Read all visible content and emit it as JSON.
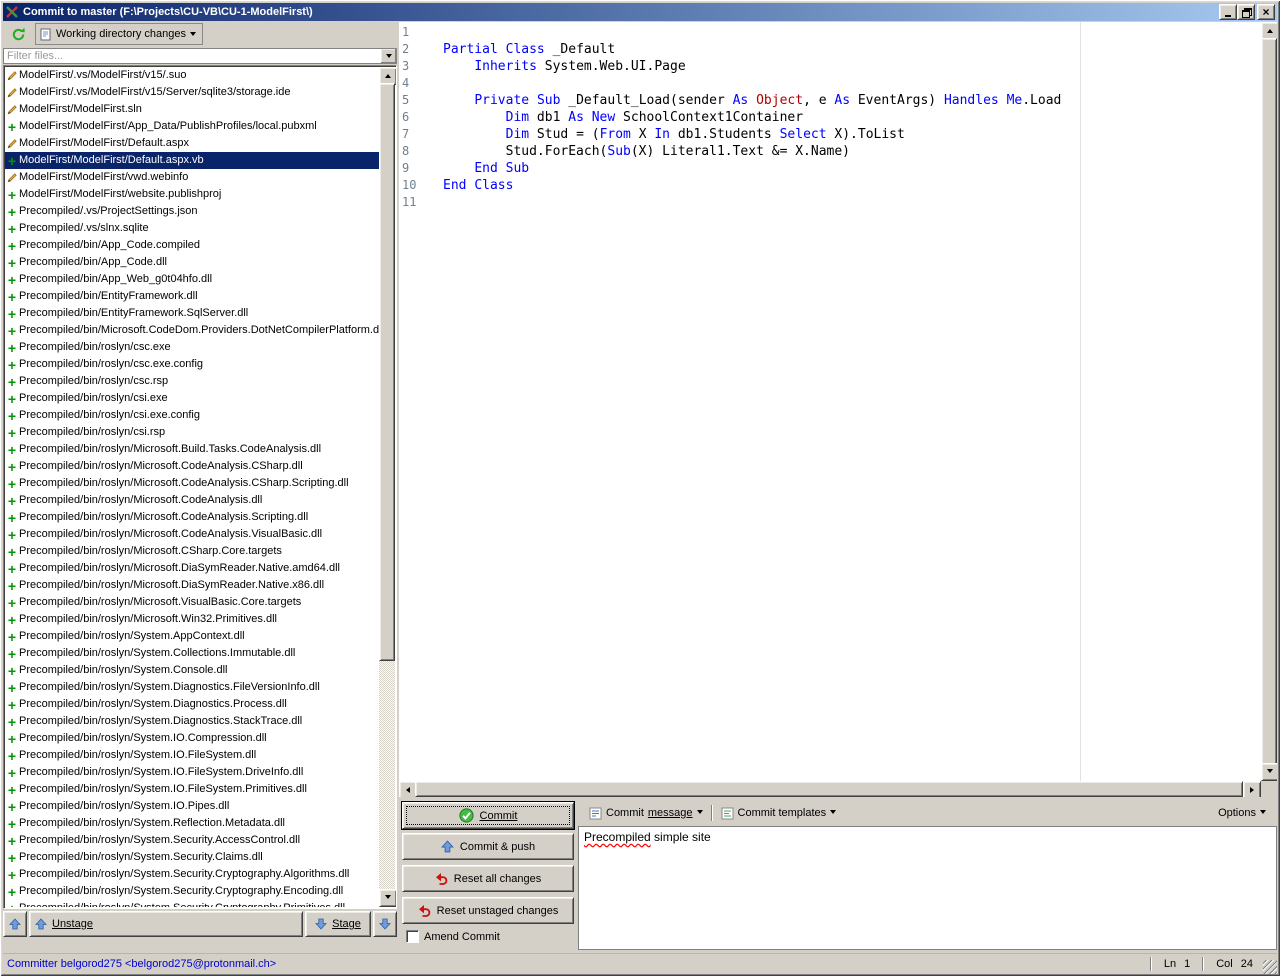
{
  "colors": {
    "selection": "#0a246a",
    "keyword": "#0000ff",
    "datatype": "#b00000",
    "added": "#009900",
    "committer_text": "#0000cc",
    "titlebar_left": "#0a246a",
    "titlebar_right": "#a6caf0",
    "spell_squiggle": "#ff0000"
  },
  "icons": {
    "close-icon": "×",
    "added-icon": "+",
    "dropdown-arrow": "▼"
  },
  "window": {
    "title": "Commit to master (F:\\Projects\\CU-VB\\CU-1-ModelFirst\\)"
  },
  "left_panel": {
    "view_dropdown": "Working directory changes",
    "filter_placeholder": "Filter files...",
    "footer": {
      "unstage": "Unstage",
      "stage": "Stage"
    },
    "files": [
      {
        "name": "ModelFirst/.vs/ModelFirst/v15/.suo",
        "status": "modified",
        "selected": false
      },
      {
        "name": "ModelFirst/.vs/ModelFirst/v15/Server/sqlite3/storage.ide",
        "status": "modified",
        "selected": false
      },
      {
        "name": "ModelFirst/ModelFirst.sln",
        "status": "modified",
        "selected": false
      },
      {
        "name": "ModelFirst/ModelFirst/App_Data/PublishProfiles/local.pubxml",
        "status": "added",
        "selected": false
      },
      {
        "name": "ModelFirst/ModelFirst/Default.aspx",
        "status": "modified",
        "selected": false
      },
      {
        "name": "ModelFirst/ModelFirst/Default.aspx.vb",
        "status": "added",
        "selected": true
      },
      {
        "name": "ModelFirst/ModelFirst/vwd.webinfo",
        "status": "modified",
        "selected": false
      },
      {
        "name": "ModelFirst/ModelFirst/website.publishproj",
        "status": "added",
        "selected": false
      },
      {
        "name": "Precompiled/.vs/ProjectSettings.json",
        "status": "added",
        "selected": false
      },
      {
        "name": "Precompiled/.vs/slnx.sqlite",
        "status": "added",
        "selected": false
      },
      {
        "name": "Precompiled/bin/App_Code.compiled",
        "status": "added",
        "selected": false
      },
      {
        "name": "Precompiled/bin/App_Code.dll",
        "status": "added",
        "selected": false
      },
      {
        "name": "Precompiled/bin/App_Web_g0t04hfo.dll",
        "status": "added",
        "selected": false
      },
      {
        "name": "Precompiled/bin/EntityFramework.dll",
        "status": "added",
        "selected": false
      },
      {
        "name": "Precompiled/bin/EntityFramework.SqlServer.dll",
        "status": "added",
        "selected": false
      },
      {
        "name": "Precompiled/bin/Microsoft.CodeDom.Providers.DotNetCompilerPlatform.dll",
        "status": "added",
        "selected": false
      },
      {
        "name": "Precompiled/bin/roslyn/csc.exe",
        "status": "added",
        "selected": false
      },
      {
        "name": "Precompiled/bin/roslyn/csc.exe.config",
        "status": "added",
        "selected": false
      },
      {
        "name": "Precompiled/bin/roslyn/csc.rsp",
        "status": "added",
        "selected": false
      },
      {
        "name": "Precompiled/bin/roslyn/csi.exe",
        "status": "added",
        "selected": false
      },
      {
        "name": "Precompiled/bin/roslyn/csi.exe.config",
        "status": "added",
        "selected": false
      },
      {
        "name": "Precompiled/bin/roslyn/csi.rsp",
        "status": "added",
        "selected": false
      },
      {
        "name": "Precompiled/bin/roslyn/Microsoft.Build.Tasks.CodeAnalysis.dll",
        "status": "added",
        "selected": false
      },
      {
        "name": "Precompiled/bin/roslyn/Microsoft.CodeAnalysis.CSharp.dll",
        "status": "added",
        "selected": false
      },
      {
        "name": "Precompiled/bin/roslyn/Microsoft.CodeAnalysis.CSharp.Scripting.dll",
        "status": "added",
        "selected": false
      },
      {
        "name": "Precompiled/bin/roslyn/Microsoft.CodeAnalysis.dll",
        "status": "added",
        "selected": false
      },
      {
        "name": "Precompiled/bin/roslyn/Microsoft.CodeAnalysis.Scripting.dll",
        "status": "added",
        "selected": false
      },
      {
        "name": "Precompiled/bin/roslyn/Microsoft.CodeAnalysis.VisualBasic.dll",
        "status": "added",
        "selected": false
      },
      {
        "name": "Precompiled/bin/roslyn/Microsoft.CSharp.Core.targets",
        "status": "added",
        "selected": false
      },
      {
        "name": "Precompiled/bin/roslyn/Microsoft.DiaSymReader.Native.amd64.dll",
        "status": "added",
        "selected": false
      },
      {
        "name": "Precompiled/bin/roslyn/Microsoft.DiaSymReader.Native.x86.dll",
        "status": "added",
        "selected": false
      },
      {
        "name": "Precompiled/bin/roslyn/Microsoft.VisualBasic.Core.targets",
        "status": "added",
        "selected": false
      },
      {
        "name": "Precompiled/bin/roslyn/Microsoft.Win32.Primitives.dll",
        "status": "added",
        "selected": false
      },
      {
        "name": "Precompiled/bin/roslyn/System.AppContext.dll",
        "status": "added",
        "selected": false
      },
      {
        "name": "Precompiled/bin/roslyn/System.Collections.Immutable.dll",
        "status": "added",
        "selected": false
      },
      {
        "name": "Precompiled/bin/roslyn/System.Console.dll",
        "status": "added",
        "selected": false
      },
      {
        "name": "Precompiled/bin/roslyn/System.Diagnostics.FileVersionInfo.dll",
        "status": "added",
        "selected": false
      },
      {
        "name": "Precompiled/bin/roslyn/System.Diagnostics.Process.dll",
        "status": "added",
        "selected": false
      },
      {
        "name": "Precompiled/bin/roslyn/System.Diagnostics.StackTrace.dll",
        "status": "added",
        "selected": false
      },
      {
        "name": "Precompiled/bin/roslyn/System.IO.Compression.dll",
        "status": "added",
        "selected": false
      },
      {
        "name": "Precompiled/bin/roslyn/System.IO.FileSystem.dll",
        "status": "added",
        "selected": false
      },
      {
        "name": "Precompiled/bin/roslyn/System.IO.FileSystem.DriveInfo.dll",
        "status": "added",
        "selected": false
      },
      {
        "name": "Precompiled/bin/roslyn/System.IO.FileSystem.Primitives.dll",
        "status": "added",
        "selected": false
      },
      {
        "name": "Precompiled/bin/roslyn/System.IO.Pipes.dll",
        "status": "added",
        "selected": false
      },
      {
        "name": "Precompiled/bin/roslyn/System.Reflection.Metadata.dll",
        "status": "added",
        "selected": false
      },
      {
        "name": "Precompiled/bin/roslyn/System.Security.AccessControl.dll",
        "status": "added",
        "selected": false
      },
      {
        "name": "Precompiled/bin/roslyn/System.Security.Claims.dll",
        "status": "added",
        "selected": false
      },
      {
        "name": "Precompiled/bin/roslyn/System.Security.Cryptography.Algorithms.dll",
        "status": "added",
        "selected": false
      },
      {
        "name": "Precompiled/bin/roslyn/System.Security.Cryptography.Encoding.dll",
        "status": "added",
        "selected": false
      },
      {
        "name": "Precompiled/bin/roslyn/System.Security.Cryptography.Primitives.dll",
        "status": "added",
        "selected": false
      }
    ]
  },
  "editor": {
    "lines": [
      {
        "n": "1",
        "segs": []
      },
      {
        "n": "2",
        "segs": [
          [
            "kw",
            "Partial"
          ],
          [
            "pl",
            " "
          ],
          [
            "kw",
            "Class"
          ],
          [
            "pl",
            " _Default"
          ]
        ]
      },
      {
        "n": "3",
        "segs": [
          [
            "pl",
            "    "
          ],
          [
            "kw",
            "Inherits"
          ],
          [
            "pl",
            " System.Web.UI.Page"
          ]
        ]
      },
      {
        "n": "4",
        "segs": []
      },
      {
        "n": "5",
        "segs": [
          [
            "pl",
            "    "
          ],
          [
            "kw",
            "Private"
          ],
          [
            "pl",
            " "
          ],
          [
            "kw",
            "Sub"
          ],
          [
            "pl",
            " _Default_Load(sender "
          ],
          [
            "kw",
            "As"
          ],
          [
            "pl",
            " "
          ],
          [
            "ty",
            "Object"
          ],
          [
            "pl",
            ", e "
          ],
          [
            "kw",
            "As"
          ],
          [
            "pl",
            " EventArgs) "
          ],
          [
            "kw",
            "Handles"
          ],
          [
            "pl",
            " "
          ],
          [
            "kw",
            "Me"
          ],
          [
            "pl",
            ".Load"
          ]
        ]
      },
      {
        "n": "6",
        "segs": [
          [
            "pl",
            "        "
          ],
          [
            "kw",
            "Dim"
          ],
          [
            "pl",
            " db1 "
          ],
          [
            "kw",
            "As"
          ],
          [
            "pl",
            " "
          ],
          [
            "kw",
            "New"
          ],
          [
            "pl",
            " SchoolContext1Container"
          ]
        ]
      },
      {
        "n": "7",
        "segs": [
          [
            "pl",
            "        "
          ],
          [
            "kw",
            "Dim"
          ],
          [
            "pl",
            " Stud = ("
          ],
          [
            "kw",
            "From"
          ],
          [
            "pl",
            " X "
          ],
          [
            "kw",
            "In"
          ],
          [
            "pl",
            " db1.Students "
          ],
          [
            "kw",
            "Select"
          ],
          [
            "pl",
            " X).ToList"
          ]
        ]
      },
      {
        "n": "8",
        "segs": [
          [
            "pl",
            "        Stud.ForEach("
          ],
          [
            "kw",
            "Sub"
          ],
          [
            "pl",
            "(X) Literal1.Text &= X.Name)"
          ]
        ]
      },
      {
        "n": "9",
        "segs": [
          [
            "pl",
            "    "
          ],
          [
            "kw",
            "End"
          ],
          [
            "pl",
            " "
          ],
          [
            "kw",
            "Sub"
          ]
        ]
      },
      {
        "n": "10",
        "segs": [
          [
            "kw",
            "End"
          ],
          [
            "pl",
            " "
          ],
          [
            "kw",
            "Class"
          ]
        ]
      },
      {
        "n": "11",
        "segs": []
      }
    ]
  },
  "commit_panel": {
    "buttons": {
      "commit": "Commit",
      "commit_push": "Commit & push",
      "reset_all": "Reset all changes",
      "reset_unstaged": "Reset unstaged changes",
      "amend": "Amend Commit"
    },
    "toolbar": {
      "message_pre": "Commit ",
      "message_u": "message",
      "templates": "Commit templates",
      "options": "Options"
    },
    "message_misspelled": "Precompiled",
    "message_rest": " simple site"
  },
  "status_bar": {
    "committer": "Committer belgorod275 <belgorod275@protonmail.ch>",
    "line_label": "Ln",
    "line_value": "1",
    "col_label": "Col",
    "col_value": "24"
  }
}
